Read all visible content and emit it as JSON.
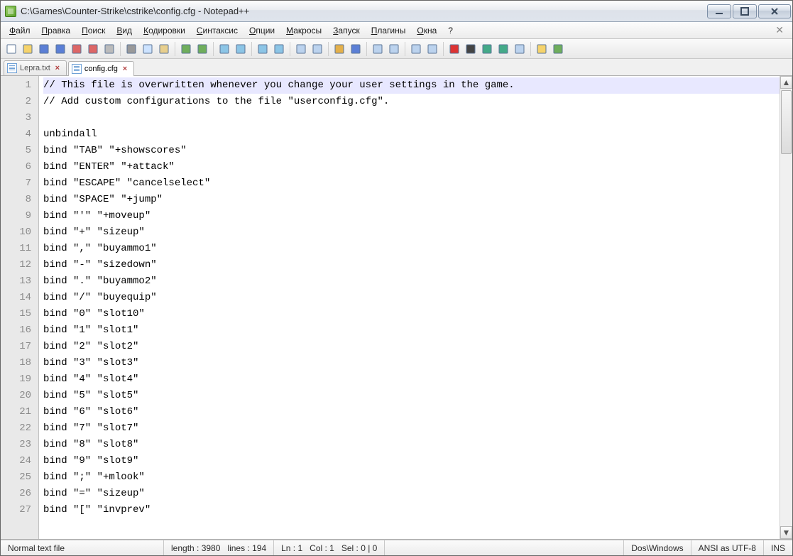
{
  "window": {
    "title": "C:\\Games\\Counter-Strike\\cstrike\\config.cfg - Notepad++"
  },
  "menu": {
    "items": [
      {
        "label": "Файл",
        "accel": 0
      },
      {
        "label": "Правка",
        "accel": 0
      },
      {
        "label": "Поиск",
        "accel": 0
      },
      {
        "label": "Вид",
        "accel": 0
      },
      {
        "label": "Кодировки",
        "accel": 0
      },
      {
        "label": "Синтаксис",
        "accel": 0
      },
      {
        "label": "Опции",
        "accel": 0
      },
      {
        "label": "Макросы",
        "accel": 0
      },
      {
        "label": "Запуск",
        "accel": 0
      },
      {
        "label": "Плагины",
        "accel": 0
      },
      {
        "label": "Окна",
        "accel": 0
      },
      {
        "label": "?",
        "accel": -1
      }
    ]
  },
  "tabs": {
    "items": [
      {
        "label": "Lepra.txt",
        "active": false
      },
      {
        "label": "config.cfg",
        "active": true
      }
    ]
  },
  "editor": {
    "lines": [
      "// This file is overwritten whenever you change your user settings in the game.",
      "// Add custom configurations to the file \"userconfig.cfg\".",
      "",
      "unbindall",
      "bind \"TAB\" \"+showscores\"",
      "bind \"ENTER\" \"+attack\"",
      "bind \"ESCAPE\" \"cancelselect\"",
      "bind \"SPACE\" \"+jump\"",
      "bind \"'\" \"+moveup\"",
      "bind \"+\" \"sizeup\"",
      "bind \",\" \"buyammo1\"",
      "bind \"-\" \"sizedown\"",
      "bind \".\" \"buyammo2\"",
      "bind \"/\" \"buyequip\"",
      "bind \"0\" \"slot10\"",
      "bind \"1\" \"slot1\"",
      "bind \"2\" \"slot2\"",
      "bind \"3\" \"slot3\"",
      "bind \"4\" \"slot4\"",
      "bind \"5\" \"slot5\"",
      "bind \"6\" \"slot6\"",
      "bind \"7\" \"slot7\"",
      "bind \"8\" \"slot8\"",
      "bind \"9\" \"slot9\"",
      "bind \";\" \"+mlook\"",
      "bind \"=\" \"sizeup\"",
      "bind \"[\" \"invprev\""
    ],
    "currentLine": 1
  },
  "status": {
    "filetype": "Normal text file",
    "length_label": "length : 3980",
    "lines_label": "lines : 194",
    "ln_label": "Ln : 1",
    "col_label": "Col : 1",
    "sel_label": "Sel : 0 | 0",
    "eol": "Dos\\Windows",
    "encoding": "ANSI as UTF-8",
    "ovr": "INS"
  },
  "toolbar_icons": [
    "new-file-icon",
    "open-file-icon",
    "save-icon",
    "save-all-icon",
    "close-icon",
    "close-all-icon",
    "print-icon",
    "sep",
    "cut-icon",
    "copy-icon",
    "paste-icon",
    "sep",
    "undo-icon",
    "redo-icon",
    "sep",
    "find-icon",
    "replace-icon",
    "sep",
    "zoom-in-icon",
    "zoom-out-icon",
    "sep",
    "sync-vscroll-icon",
    "sync-hscroll-icon",
    "sep",
    "wordwrap-icon",
    "show-all-chars-icon",
    "sep",
    "indent-guide-icon",
    "user-lang-icon",
    "sep",
    "doc-map-icon",
    "func-list-icon",
    "sep",
    "record-macro-icon",
    "stop-macro-icon",
    "play-macro-icon",
    "play-multi-icon",
    "save-macro-icon",
    "sep",
    "folder-icon",
    "spellcheck-icon"
  ]
}
